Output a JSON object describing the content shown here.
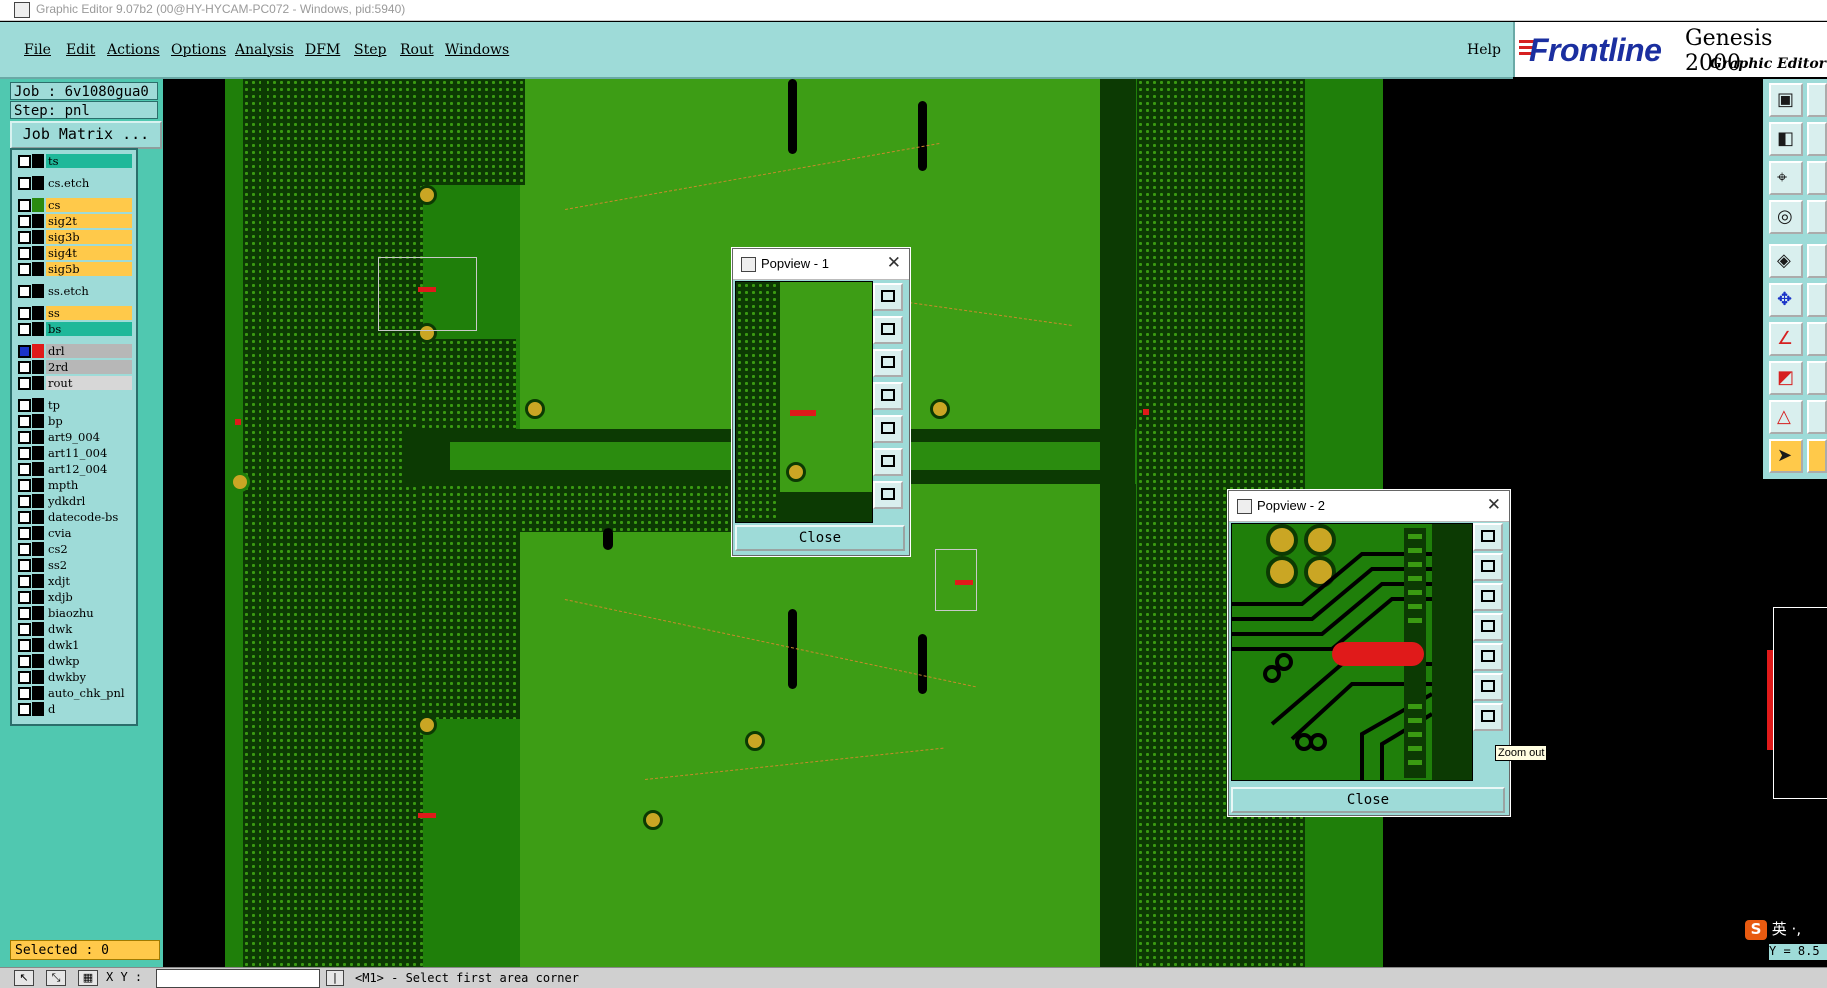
{
  "window": {
    "title": "Graphic Editor 9.07b2 (00@HY-HYCAM-PC072 - Windows, pid:5940)"
  },
  "menu": {
    "items": [
      "File",
      "Edit",
      "Actions",
      "Options",
      "Analysis",
      "DFM",
      "Step",
      "Rout",
      "Windows"
    ],
    "help": "Help"
  },
  "logo": {
    "brand": "Frontline",
    "product": "Genesis 2000",
    "module": "Graphic Editor"
  },
  "job": {
    "job_label": "Job : 6v1080gua0",
    "step_label": "Step: pnl",
    "matrix_button": "Job Matrix ..."
  },
  "layers": [
    {
      "name": "ts",
      "color": "#1fb89a",
      "swatch": "#000000",
      "checked": false
    },
    {
      "name": "cs.etch",
      "color": "#9edbd8",
      "swatch": "#000000",
      "checked": false
    },
    {
      "name": "cs",
      "color": "#ffc94a",
      "swatch": "#2a8a10",
      "checked": false
    },
    {
      "name": "sig2t",
      "color": "#ffc94a",
      "swatch": "#000000",
      "checked": false
    },
    {
      "name": "sig3b",
      "color": "#ffc94a",
      "swatch": "#000000",
      "checked": false
    },
    {
      "name": "sig4t",
      "color": "#ffc94a",
      "swatch": "#000000",
      "checked": false
    },
    {
      "name": "sig5b",
      "color": "#ffc94a",
      "swatch": "#000000",
      "checked": false
    },
    {
      "name": "ss.etch",
      "color": "#9edbd8",
      "swatch": "#000000",
      "checked": false
    },
    {
      "name": "ss",
      "color": "#ffc94a",
      "swatch": "#000000",
      "checked": false
    },
    {
      "name": "bs",
      "color": "#1fb89a",
      "swatch": "#000000",
      "checked": false
    },
    {
      "name": "drl",
      "color": "#b7b7b7",
      "swatch": "#e01a1a",
      "checked": true
    },
    {
      "name": "2rd",
      "color": "#b7b7b7",
      "swatch": "#000000",
      "checked": false
    },
    {
      "name": "rout",
      "color": "#d7d7d7",
      "swatch": "#000000",
      "checked": false
    },
    {
      "name": "tp",
      "color": "#9edbd8",
      "swatch": "#000000",
      "checked": false
    },
    {
      "name": "bp",
      "color": "#9edbd8",
      "swatch": "#000000",
      "checked": false
    },
    {
      "name": "art9_004",
      "color": "#9edbd8",
      "swatch": "#000000",
      "checked": false
    },
    {
      "name": "art11_004",
      "color": "#9edbd8",
      "swatch": "#000000",
      "checked": false
    },
    {
      "name": "art12_004",
      "color": "#9edbd8",
      "swatch": "#000000",
      "checked": false
    },
    {
      "name": "mpth",
      "color": "#9edbd8",
      "swatch": "#000000",
      "checked": false
    },
    {
      "name": "ydkdrl",
      "color": "#9edbd8",
      "swatch": "#000000",
      "checked": false
    },
    {
      "name": "datecode-bs",
      "color": "#9edbd8",
      "swatch": "#000000",
      "checked": false
    },
    {
      "name": "cvia",
      "color": "#9edbd8",
      "swatch": "#000000",
      "checked": false
    },
    {
      "name": "cs2",
      "color": "#9edbd8",
      "swatch": "#000000",
      "checked": false
    },
    {
      "name": "ss2",
      "color": "#9edbd8",
      "swatch": "#000000",
      "checked": false
    },
    {
      "name": "xdjt",
      "color": "#9edbd8",
      "swatch": "#000000",
      "checked": false
    },
    {
      "name": "xdjb",
      "color": "#9edbd8",
      "swatch": "#000000",
      "checked": false
    },
    {
      "name": "biaozhu",
      "color": "#9edbd8",
      "swatch": "#000000",
      "checked": false
    },
    {
      "name": "dwk",
      "color": "#9edbd8",
      "swatch": "#000000",
      "checked": false
    },
    {
      "name": "dwk1",
      "color": "#9edbd8",
      "swatch": "#000000",
      "checked": false
    },
    {
      "name": "dwkp",
      "color": "#9edbd8",
      "swatch": "#000000",
      "checked": false
    },
    {
      "name": "dwkby",
      "color": "#9edbd8",
      "swatch": "#000000",
      "checked": false
    },
    {
      "name": "auto_chk_pnl",
      "color": "#9edbd8",
      "swatch": "#000000",
      "checked": false
    },
    {
      "name": "d",
      "color": "#9edbd8",
      "swatch": "#000000",
      "checked": false
    }
  ],
  "selected_label": "Selected : 0",
  "popview1": {
    "title": "Popview - 1",
    "close_label": "Close"
  },
  "popview2": {
    "title": "Popview - 2",
    "close_label": "Close",
    "tooltip": "Zoom out"
  },
  "status": {
    "xy_label": "X Y :",
    "xy_value": "",
    "prompt": "<M1> - Select first area corner",
    "y_readout": "Y = 8.5"
  },
  "ime": {
    "glyph": "S",
    "text": "英 ·,"
  }
}
